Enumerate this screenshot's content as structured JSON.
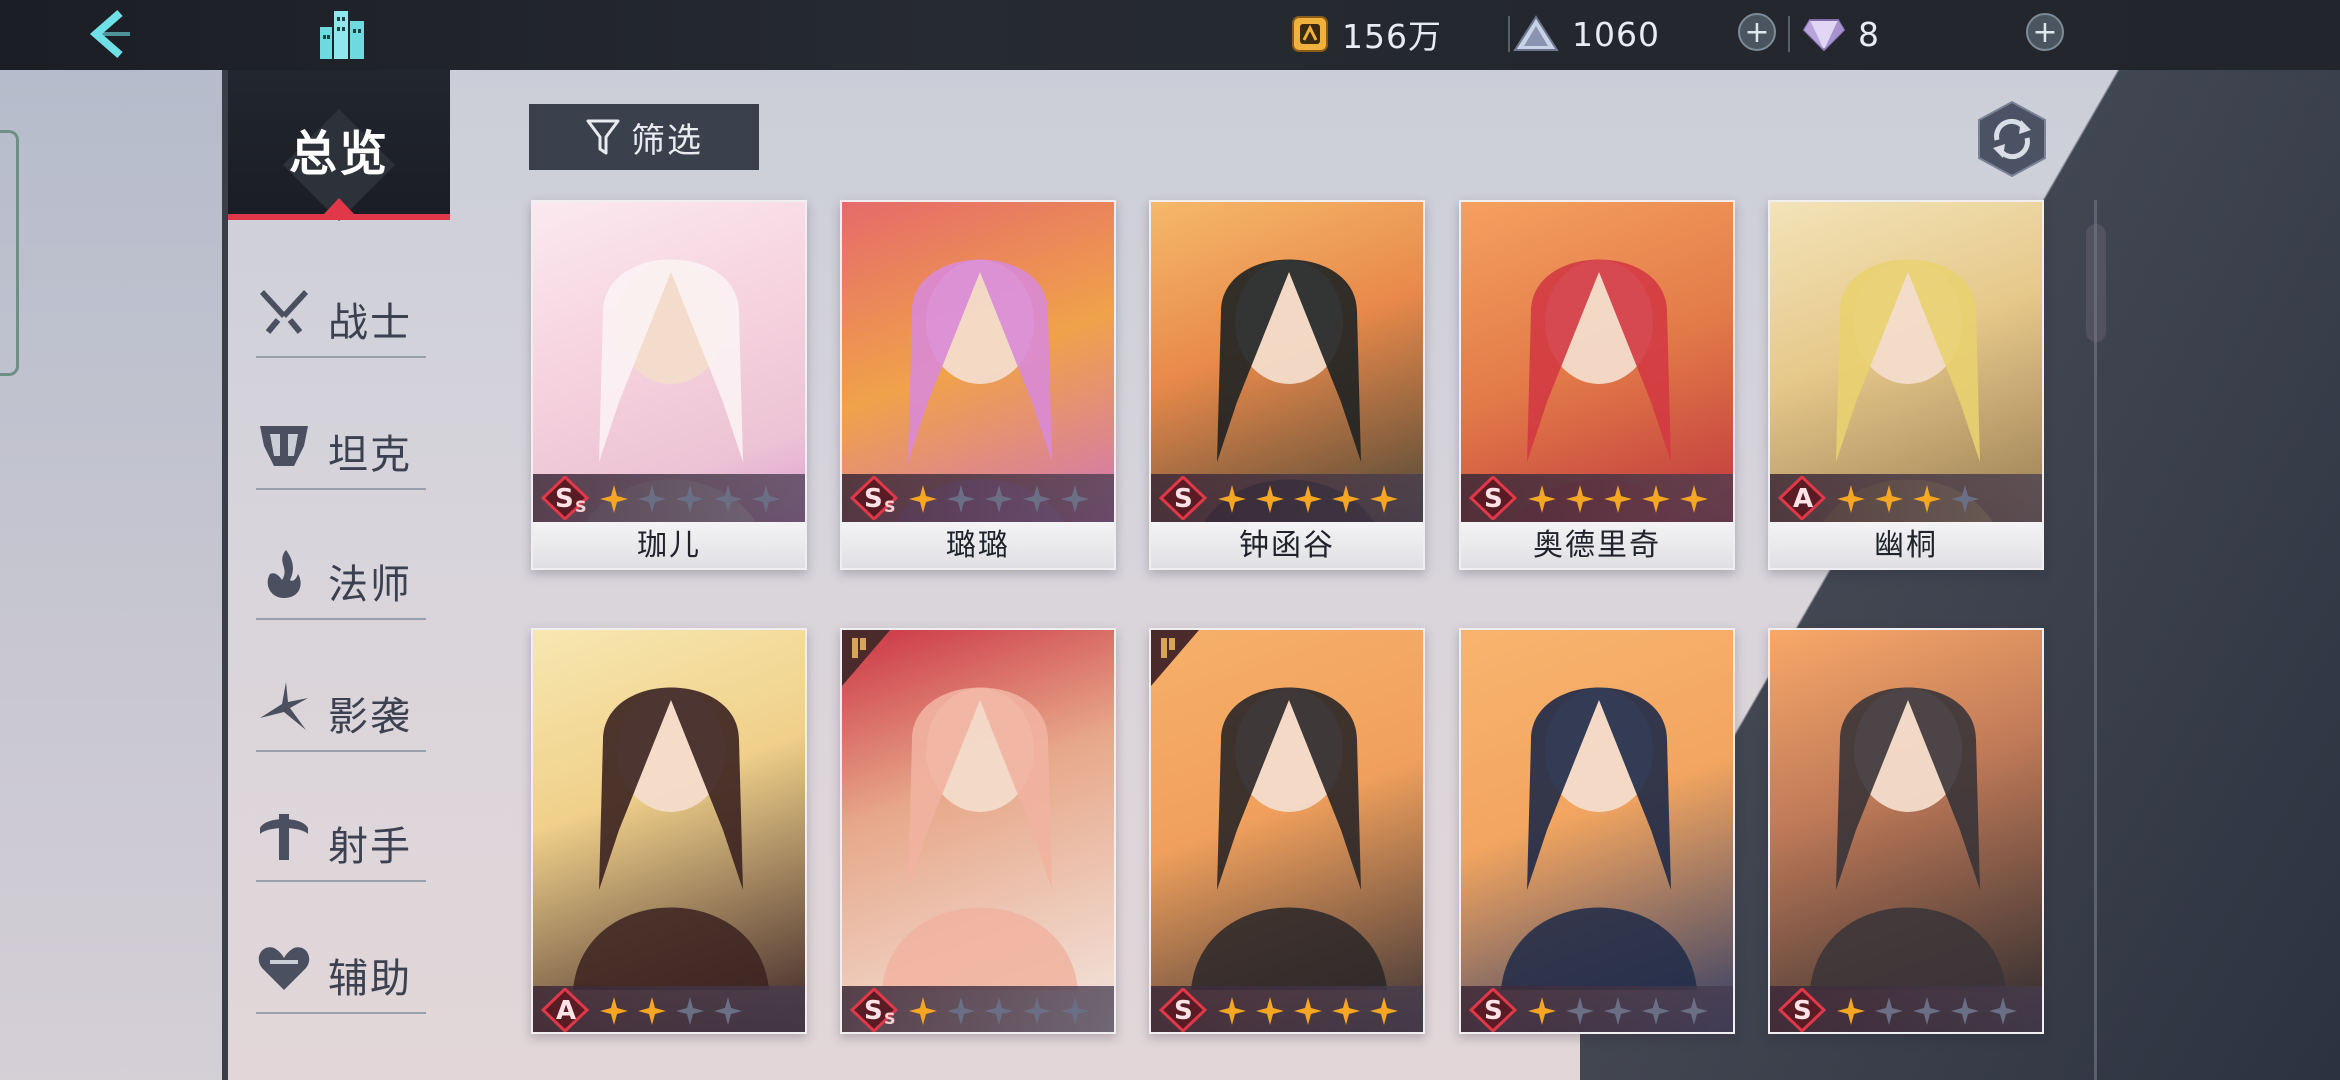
{
  "topbar": {
    "back_icon": "back-chevron-icon",
    "home_icon": "city-icon",
    "gold": "156万",
    "pyramid": "1060",
    "gems": "8"
  },
  "sidebar": {
    "overview": "总览",
    "categories": [
      {
        "label": "战士",
        "icon": "swords-icon"
      },
      {
        "label": "坦克",
        "icon": "helmet-icon"
      },
      {
        "label": "法师",
        "icon": "flame-icon"
      },
      {
        "label": "影袭",
        "icon": "shadow-blade-icon"
      },
      {
        "label": "射手",
        "icon": "crossbow-icon"
      },
      {
        "label": "辅助",
        "icon": "heart-icon"
      }
    ]
  },
  "toolbar": {
    "filter_label": "筛选",
    "refresh_icon": "refresh-icon"
  },
  "colors": {
    "accent_red": "#e03848",
    "star_gold": "#f5a623",
    "star_empty": "#6b6f86"
  },
  "heroes": [
    {
      "name": "珈儿",
      "rank": "SS",
      "stars": 1,
      "max_stars": 5
    },
    {
      "name": "璐璐",
      "rank": "SS",
      "stars": 1,
      "max_stars": 5
    },
    {
      "name": "钟函谷",
      "rank": "S",
      "stars": 5,
      "max_stars": 5
    },
    {
      "name": "奥德里奇",
      "rank": "S",
      "stars": 5,
      "max_stars": 5
    },
    {
      "name": "幽桐",
      "rank": "A",
      "stars": 3,
      "max_stars": 4
    },
    {
      "name": "",
      "rank": "A",
      "stars": 2,
      "max_stars": 4
    },
    {
      "name": "",
      "rank": "SS",
      "stars": 1,
      "max_stars": 5
    },
    {
      "name": "",
      "rank": "S",
      "stars": 5,
      "max_stars": 5
    },
    {
      "name": "",
      "rank": "S",
      "stars": 1,
      "max_stars": 5
    },
    {
      "name": "",
      "rank": "S",
      "stars": 1,
      "max_stars": 5
    }
  ]
}
